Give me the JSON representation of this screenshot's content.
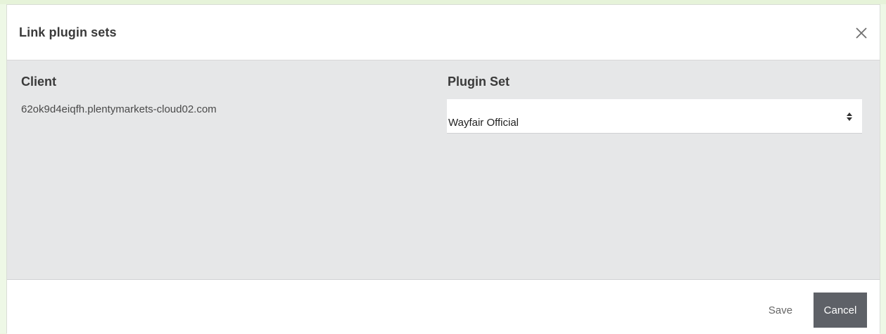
{
  "dialog": {
    "title": "Link plugin sets",
    "close_icon": "close-icon"
  },
  "body": {
    "client_label": "Client",
    "client_value": "62ok9d4eiqfh.plentymarkets-cloud02.com",
    "pluginset_label": "Plugin Set",
    "pluginset_selected": "Wayfair Official",
    "select_icon": "sort-arrows-icon"
  },
  "footer": {
    "save_label": "Save",
    "cancel_label": "Cancel"
  },
  "colors": {
    "backdrop": "#eef8e6",
    "body_bg": "#e6e7e8",
    "cancel_bg": "#5e6167"
  }
}
